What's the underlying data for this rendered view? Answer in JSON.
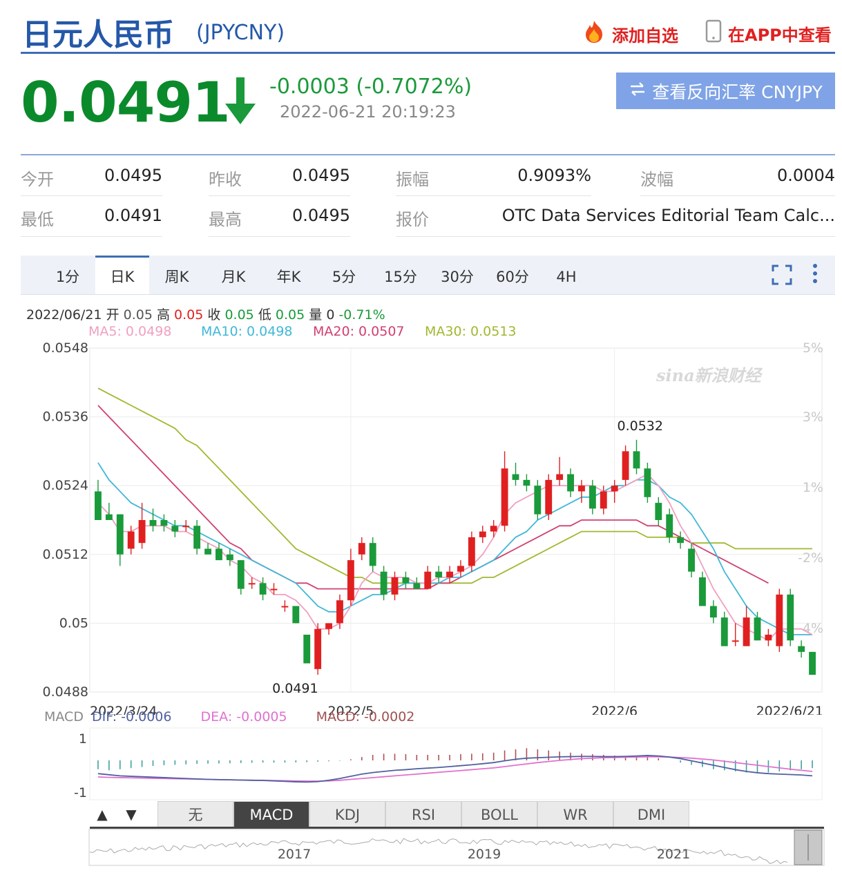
{
  "header": {
    "title": "日元人民币",
    "code": "(JPYCNY)",
    "add_watch": "添加自选",
    "view_app": "在APP中查看"
  },
  "quote": {
    "price": "0.0491",
    "change": "-0.0003 (-0.7072%)",
    "time": "2022-06-21 20:19:23",
    "reverse_button": "查看反向汇率 CNYJPY"
  },
  "stats": [
    {
      "label": "今开",
      "value": "0.0495"
    },
    {
      "label": "昨收",
      "value": "0.0495"
    },
    {
      "label": "振幅",
      "value": "0.9093%"
    },
    {
      "label": "波幅",
      "value": "0.0004"
    },
    {
      "label": "最低",
      "value": "0.0491"
    },
    {
      "label": "最高",
      "value": "0.0495"
    },
    {
      "label": "报价",
      "value": "OTC Data Services Editorial Team Calc..."
    }
  ],
  "tabs": [
    "1分",
    "日K",
    "周K",
    "月K",
    "年K",
    "5分",
    "15分",
    "30分",
    "60分",
    "4H"
  ],
  "active_tab": "日K",
  "info_line": {
    "date": "2022/06/21",
    "open_label": "开",
    "open": "0.05",
    "high_label": "高",
    "high": "0.05",
    "close_label": "收",
    "close": "0.05",
    "low_label": "低",
    "low": "0.05",
    "vol_label": "量",
    "vol": "0",
    "pct": "-0.71%"
  },
  "ma_legend": {
    "ma5": "MA5: 0.0498",
    "ma10": "MA10: 0.0498",
    "ma20": "MA20: 0.0507",
    "ma30": "MA30: 0.0513"
  },
  "watermark": "sina新浪财经",
  "macd_legend": {
    "label": "MACD",
    "dif": "DIF: -0.0006",
    "dea": "DEA: -0.0005",
    "macd": "MACD: -0.0002"
  },
  "indicator_tabs": [
    "无",
    "MACD",
    "KDJ",
    "RSI",
    "BOLL",
    "WR",
    "DMI"
  ],
  "active_indicator": "MACD",
  "overview_years": [
    "2017",
    "2019",
    "2021"
  ],
  "colors": {
    "up": "#e02020",
    "down": "#1a9a3a",
    "ma5": "#f0a0c0",
    "ma10": "#40b8d8",
    "ma20": "#d04070",
    "ma30": "#a0b830",
    "dif": "#5060a0",
    "dea": "#e070d0"
  },
  "chart_data": {
    "type": "candlestick",
    "title": "",
    "y_ticks": [
      "0.0548",
      "0.0536",
      "0.0524",
      "0.0512",
      "0.05",
      "0.0488"
    ],
    "ylim": [
      0.0488,
      0.0548
    ],
    "pct_ticks": [
      "5%",
      "3%",
      "1%",
      "-2%",
      "-4%"
    ],
    "x_ticks": [
      "2022/3/24",
      "2022/5",
      "2022/6",
      "2022/6/21"
    ],
    "annotations": [
      {
        "text": "0.0532",
        "label": "high"
      },
      {
        "text": "0.0491",
        "label": "low"
      }
    ],
    "candles": [
      [
        0.0523,
        0.0525,
        0.0518,
        0.0518
      ],
      [
        0.0519,
        0.0521,
        0.0518,
        0.0518
      ],
      [
        0.0519,
        0.0519,
        0.051,
        0.0512
      ],
      [
        0.0513,
        0.0517,
        0.0512,
        0.0516
      ],
      [
        0.0514,
        0.0521,
        0.0513,
        0.0518
      ],
      [
        0.0518,
        0.052,
        0.0516,
        0.0517
      ],
      [
        0.0518,
        0.0519,
        0.0516,
        0.0517
      ],
      [
        0.0517,
        0.0518,
        0.0515,
        0.0516
      ],
      [
        0.0517,
        0.0518,
        0.0516,
        0.0517
      ],
      [
        0.0517,
        0.0518,
        0.0512,
        0.0513
      ],
      [
        0.0513,
        0.0514,
        0.0512,
        0.0512
      ],
      [
        0.0513,
        0.0514,
        0.0511,
        0.0511
      ],
      [
        0.0512,
        0.0513,
        0.051,
        0.0511
      ],
      [
        0.0511,
        0.0511,
        0.0505,
        0.0506
      ],
      [
        0.0507,
        0.0508,
        0.0506,
        0.0507
      ],
      [
        0.0507,
        0.0508,
        0.0504,
        0.0505
      ],
      [
        0.0506,
        0.0507,
        0.0505,
        0.0506
      ],
      [
        0.0503,
        0.0504,
        0.0502,
        0.0503
      ],
      [
        0.0503,
        0.0503,
        0.05,
        0.05
      ],
      [
        0.0498,
        0.0498,
        0.0493,
        0.0493
      ],
      [
        0.0492,
        0.05,
        0.0491,
        0.0499
      ],
      [
        0.0499,
        0.05,
        0.0498,
        0.05
      ],
      [
        0.05,
        0.0505,
        0.0499,
        0.0504
      ],
      [
        0.0504,
        0.0513,
        0.0503,
        0.0511
      ],
      [
        0.0512,
        0.0515,
        0.0511,
        0.0514
      ],
      [
        0.0514,
        0.0515,
        0.0509,
        0.051
      ],
      [
        0.0509,
        0.051,
        0.0504,
        0.0505
      ],
      [
        0.0505,
        0.0509,
        0.0504,
        0.0508
      ],
      [
        0.0508,
        0.0509,
        0.0506,
        0.0507
      ],
      [
        0.0507,
        0.0508,
        0.0506,
        0.0506
      ],
      [
        0.0506,
        0.051,
        0.0506,
        0.0509
      ],
      [
        0.0509,
        0.051,
        0.0507,
        0.0508
      ],
      [
        0.0508,
        0.051,
        0.0507,
        0.0509
      ],
      [
        0.0509,
        0.0511,
        0.0508,
        0.051
      ],
      [
        0.051,
        0.0516,
        0.0509,
        0.0515
      ],
      [
        0.0515,
        0.0517,
        0.0514,
        0.0516
      ],
      [
        0.0516,
        0.0518,
        0.0515,
        0.0517
      ],
      [
        0.0517,
        0.053,
        0.0516,
        0.0527
      ],
      [
        0.0526,
        0.0528,
        0.0524,
        0.0525
      ],
      [
        0.0525,
        0.0526,
        0.0523,
        0.0524
      ],
      [
        0.0524,
        0.0525,
        0.0518,
        0.0519
      ],
      [
        0.0519,
        0.0526,
        0.0518,
        0.0525
      ],
      [
        0.0525,
        0.0529,
        0.0524,
        0.0526
      ],
      [
        0.0526,
        0.0527,
        0.0522,
        0.0523
      ],
      [
        0.0523,
        0.0525,
        0.0521,
        0.0524
      ],
      [
        0.0524,
        0.0525,
        0.0519,
        0.052
      ],
      [
        0.052,
        0.0524,
        0.0519,
        0.0523
      ],
      [
        0.0523,
        0.0525,
        0.0521,
        0.0524
      ],
      [
        0.0525,
        0.0531,
        0.0524,
        0.053
      ],
      [
        0.053,
        0.0532,
        0.0526,
        0.0527
      ],
      [
        0.0527,
        0.0528,
        0.0521,
        0.0522
      ],
      [
        0.0521,
        0.0522,
        0.0517,
        0.0518
      ],
      [
        0.0519,
        0.052,
        0.0514,
        0.0515
      ],
      [
        0.0515,
        0.0516,
        0.0513,
        0.0514
      ],
      [
        0.0513,
        0.0514,
        0.0508,
        0.0509
      ],
      [
        0.0508,
        0.0509,
        0.0503,
        0.0503
      ],
      [
        0.0503,
        0.0504,
        0.05,
        0.0501
      ],
      [
        0.0501,
        0.0502,
        0.0496,
        0.0496
      ],
      [
        0.0497,
        0.05,
        0.0496,
        0.0497
      ],
      [
        0.0496,
        0.0503,
        0.0496,
        0.0501
      ],
      [
        0.0501,
        0.0502,
        0.0497,
        0.0497
      ],
      [
        0.0497,
        0.0499,
        0.0496,
        0.0498
      ],
      [
        0.0496,
        0.0506,
        0.0495,
        0.0505
      ],
      [
        0.0505,
        0.0506,
        0.0496,
        0.0497
      ],
      [
        0.0496,
        0.0497,
        0.0494,
        0.0495
      ],
      [
        0.0495,
        0.0495,
        0.0491,
        0.0491
      ]
    ],
    "ma5": [
      0.0521,
      0.0519,
      0.0516,
      0.0516,
      0.0517,
      0.0517,
      0.0517,
      0.0516,
      0.0516,
      0.0515,
      0.0514,
      0.0513,
      0.0511,
      0.051,
      0.0508,
      0.0507,
      0.0505,
      0.0505,
      0.0504,
      0.0502,
      0.0499,
      0.0499,
      0.05,
      0.0503,
      0.0507,
      0.0509,
      0.0508,
      0.0508,
      0.0508,
      0.0507,
      0.0507,
      0.0508,
      0.0508,
      0.0509,
      0.051,
      0.0512,
      0.0515,
      0.0519,
      0.0521,
      0.0522,
      0.0523,
      0.0524,
      0.0524,
      0.0524,
      0.0524,
      0.0524,
      0.0523,
      0.0523,
      0.0524,
      0.0525,
      0.0526,
      0.0524,
      0.0521,
      0.0517,
      0.0514,
      0.051,
      0.0506,
      0.0503,
      0.05,
      0.0499,
      0.0498,
      0.0497,
      0.0499,
      0.0499,
      0.0499,
      0.0498
    ],
    "ma10": [
      0.0528,
      0.0525,
      0.0523,
      0.0521,
      0.052,
      0.0519,
      0.0518,
      0.0517,
      0.0517,
      0.0516,
      0.0515,
      0.0514,
      0.0513,
      0.0512,
      0.0511,
      0.051,
      0.0509,
      0.0508,
      0.0507,
      0.0505,
      0.0503,
      0.0502,
      0.0502,
      0.0503,
      0.0504,
      0.0505,
      0.0505,
      0.0506,
      0.0507,
      0.0507,
      0.0507,
      0.0507,
      0.0508,
      0.0508,
      0.0509,
      0.051,
      0.0511,
      0.0513,
      0.0515,
      0.0516,
      0.0518,
      0.0519,
      0.052,
      0.0521,
      0.0522,
      0.0522,
      0.0523,
      0.0524,
      0.0524,
      0.0525,
      0.0525,
      0.0524,
      0.0522,
      0.0521,
      0.0519,
      0.0516,
      0.0513,
      0.0509,
      0.0506,
      0.0503,
      0.0501,
      0.05,
      0.0499,
      0.0498,
      0.0498,
      0.0498
    ],
    "ma20": [
      0.0538,
      0.0536,
      0.0534,
      0.0532,
      0.053,
      0.0528,
      0.0526,
      0.0524,
      0.0522,
      0.052,
      0.0518,
      0.0516,
      0.0514,
      0.0513,
      0.0511,
      0.051,
      0.0509,
      0.0508,
      0.0507,
      0.0507,
      0.0506,
      0.0506,
      0.0506,
      0.0506,
      0.0506,
      0.0506,
      0.0506,
      0.0506,
      0.0506,
      0.0506,
      0.0506,
      0.0507,
      0.0507,
      0.0508,
      0.0509,
      0.051,
      0.0511,
      0.0512,
      0.0513,
      0.0514,
      0.0515,
      0.0516,
      0.0517,
      0.0517,
      0.0518,
      0.0518,
      0.0518,
      0.0518,
      0.0518,
      0.0518,
      0.0517,
      0.0517,
      0.0516,
      0.0515,
      0.0514,
      0.0513,
      0.0512,
      0.0511,
      0.051,
      0.0509,
      0.0508,
      0.0507
    ],
    "ma30": [
      0.0541,
      0.054,
      0.0539,
      0.0538,
      0.0537,
      0.0536,
      0.0535,
      0.0534,
      0.0532,
      0.0531,
      0.0529,
      0.0527,
      0.0525,
      0.0523,
      0.0521,
      0.0519,
      0.0517,
      0.0515,
      0.0513,
      0.0512,
      0.0511,
      0.051,
      0.0509,
      0.0508,
      0.0508,
      0.0507,
      0.0507,
      0.0507,
      0.0507,
      0.0507,
      0.0507,
      0.0507,
      0.0507,
      0.0507,
      0.0507,
      0.0508,
      0.0508,
      0.0509,
      0.051,
      0.0511,
      0.0512,
      0.0513,
      0.0514,
      0.0515,
      0.0516,
      0.0516,
      0.0516,
      0.0516,
      0.0516,
      0.0516,
      0.0515,
      0.0515,
      0.0515,
      0.0515,
      0.0514,
      0.0514,
      0.0514,
      0.0514,
      0.0513,
      0.0513,
      0.0513,
      0.0513,
      0.0513,
      0.0513,
      0.0513,
      0.0513
    ],
    "macd_ticks": [
      "1",
      "-1"
    ],
    "macd_ylim": [
      -1.2,
      1.2
    ],
    "macd_bars": [
      -0.4,
      -0.45,
      -0.4,
      -0.35,
      -0.3,
      -0.25,
      -0.22,
      -0.2,
      -0.18,
      -0.16,
      -0.15,
      -0.14,
      -0.13,
      -0.12,
      -0.11,
      -0.1,
      -0.1,
      -0.1,
      -0.09,
      -0.08,
      -0.06,
      -0.04,
      -0.02,
      0.05,
      0.15,
      0.25,
      0.3,
      0.3,
      0.28,
      0.25,
      0.25,
      0.25,
      0.25,
      0.28,
      0.3,
      0.32,
      0.35,
      0.45,
      0.5,
      0.55,
      0.5,
      0.45,
      0.4,
      0.35,
      0.3,
      0.28,
      0.25,
      0.22,
      0.2,
      0.18,
      0.15,
      0.1,
      0.0,
      -0.1,
      -0.2,
      -0.3,
      -0.4,
      -0.45,
      -0.5,
      -0.55,
      -0.55,
      -0.55,
      -0.5,
      -0.45,
      -0.4,
      -0.35
    ],
    "dif": [
      -0.6,
      -0.65,
      -0.7,
      -0.72,
      -0.74,
      -0.76,
      -0.78,
      -0.8,
      -0.82,
      -0.84,
      -0.86,
      -0.87,
      -0.88,
      -0.89,
      -0.9,
      -0.91,
      -0.93,
      -0.95,
      -0.97,
      -0.98,
      -0.96,
      -0.9,
      -0.82,
      -0.72,
      -0.62,
      -0.55,
      -0.5,
      -0.45,
      -0.42,
      -0.38,
      -0.35,
      -0.32,
      -0.28,
      -0.24,
      -0.2,
      -0.15,
      -0.1,
      -0.02,
      0.05,
      0.1,
      0.12,
      0.14,
      0.16,
      0.17,
      0.18,
      0.18,
      0.17,
      0.17,
      0.18,
      0.2,
      0.22,
      0.2,
      0.15,
      0.08,
      -0.02,
      -0.12,
      -0.22,
      -0.32,
      -0.42,
      -0.5,
      -0.56,
      -0.6,
      -0.62,
      -0.64,
      -0.66,
      -0.7
    ],
    "dea": [
      -0.75,
      -0.77,
      -0.78,
      -0.79,
      -0.8,
      -0.81,
      -0.82,
      -0.83,
      -0.84,
      -0.85,
      -0.86,
      -0.87,
      -0.88,
      -0.89,
      -0.9,
      -0.9,
      -0.91,
      -0.92,
      -0.93,
      -0.94,
      -0.94,
      -0.93,
      -0.9,
      -0.86,
      -0.82,
      -0.78,
      -0.74,
      -0.7,
      -0.66,
      -0.62,
      -0.58,
      -0.54,
      -0.5,
      -0.46,
      -0.42,
      -0.38,
      -0.34,
      -0.28,
      -0.22,
      -0.16,
      -0.1,
      -0.05,
      0.0,
      0.04,
      0.08,
      0.1,
      0.12,
      0.13,
      0.14,
      0.15,
      0.16,
      0.16,
      0.15,
      0.13,
      0.1,
      0.06,
      0.02,
      -0.04,
      -0.1,
      -0.16,
      -0.22,
      -0.28,
      -0.34,
      -0.4,
      -0.45,
      -0.5
    ]
  }
}
